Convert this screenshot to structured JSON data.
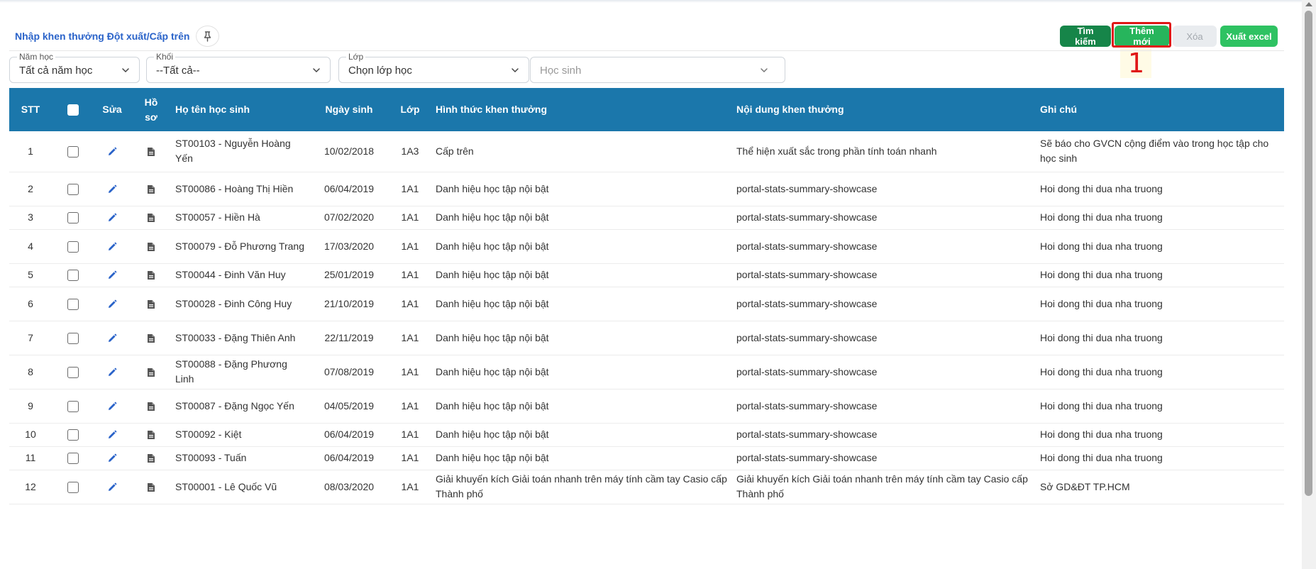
{
  "header": {
    "title": "Nhập khen thưởng Đột xuất/Cấp trên",
    "pin_icon": "pin-icon"
  },
  "toolbar": {
    "search_label": "Tìm kiếm",
    "add_label": "Thêm mới",
    "delete_label": "Xóa",
    "export_label": "Xuất excel"
  },
  "annotation": {
    "step": "1",
    "color": "#e01717"
  },
  "filters": {
    "school_year": {
      "label": "Năm học",
      "value": "Tất cả năm học"
    },
    "grade": {
      "label": "Khối",
      "value": "--Tất cả--"
    },
    "class": {
      "label": "Lớp",
      "value": "Chọn lớp học"
    },
    "student": {
      "placeholder": "Học sinh"
    }
  },
  "table": {
    "header_color": "#1b77ab",
    "columns": {
      "stt": "STT",
      "edit": "Sửa",
      "profile_1": "Hồ",
      "profile_2": "sơ",
      "name": "Họ tên học sinh",
      "dob": "Ngày sinh",
      "class": "Lớp",
      "award_type": "Hình thức khen thưởng",
      "award_content": "Nội dung khen thưởng",
      "note": "Ghi chú"
    },
    "rows": [
      {
        "stt": "1",
        "name": "ST00103 - Nguyễn Hoàng Yến",
        "dob": "10/02/2018",
        "class": "1A3",
        "award_type": "Cấp trên",
        "award_content": "Thể hiện xuất sắc trong phần tính toán nhanh",
        "note": "Sẽ báo cho GVCN cộng điểm vào trong học tập cho học sinh"
      },
      {
        "stt": "2",
        "name": "ST00086 - Hoàng Thị Hiền",
        "dob": "06/04/2019",
        "class": "1A1",
        "award_type": "Danh hiệu học tập nội bật",
        "award_content": "portal-stats-summary-showcase",
        "note": "Hoi dong thi dua nha truong"
      },
      {
        "stt": "3",
        "name": "ST00057 - Hiền Hà",
        "dob": "07/02/2020",
        "class": "1A1",
        "award_type": "Danh hiệu học tập nội bật",
        "award_content": "portal-stats-summary-showcase",
        "note": "Hoi dong thi dua nha truong"
      },
      {
        "stt": "4",
        "name": "ST00079 - Đỗ Phương Trang",
        "dob": "17/03/2020",
        "class": "1A1",
        "award_type": "Danh hiệu học tập nội bật",
        "award_content": "portal-stats-summary-showcase",
        "note": "Hoi dong thi dua nha truong"
      },
      {
        "stt": "5",
        "name": "ST00044 - Đinh Văn Huy",
        "dob": "25/01/2019",
        "class": "1A1",
        "award_type": "Danh hiệu học tập nội bật",
        "award_content": "portal-stats-summary-showcase",
        "note": "Hoi dong thi dua nha truong"
      },
      {
        "stt": "6",
        "name": "ST00028 - Đinh Công Huy",
        "dob": "21/10/2019",
        "class": "1A1",
        "award_type": "Danh hiệu học tập nội bật",
        "award_content": "portal-stats-summary-showcase",
        "note": "Hoi dong thi dua nha truong"
      },
      {
        "stt": "7",
        "name": "ST00033 - Đặng Thiên Anh",
        "dob": "22/11/2019",
        "class": "1A1",
        "award_type": "Danh hiệu học tập nội bật",
        "award_content": "portal-stats-summary-showcase",
        "note": "Hoi dong thi dua nha truong"
      },
      {
        "stt": "8",
        "name": "ST00088 - Đặng Phương Linh",
        "dob": "07/08/2019",
        "class": "1A1",
        "award_type": "Danh hiệu học tập nội bật",
        "award_content": "portal-stats-summary-showcase",
        "note": "Hoi dong thi dua nha truong"
      },
      {
        "stt": "9",
        "name": "ST00087 - Đặng Ngọc Yến",
        "dob": "04/05/2019",
        "class": "1A1",
        "award_type": "Danh hiệu học tập nội bật",
        "award_content": "portal-stats-summary-showcase",
        "note": "Hoi dong thi dua nha truong"
      },
      {
        "stt": "10",
        "name": "ST00092 - Kiệt",
        "dob": "06/04/2019",
        "class": "1A1",
        "award_type": "Danh hiệu học tập nội bật",
        "award_content": "portal-stats-summary-showcase",
        "note": "Hoi dong thi dua nha truong"
      },
      {
        "stt": "11",
        "name": "ST00093 - Tuấn",
        "dob": "06/04/2019",
        "class": "1A1",
        "award_type": "Danh hiệu học tập nội bật",
        "award_content": "portal-stats-summary-showcase",
        "note": "Hoi dong thi dua nha truong"
      },
      {
        "stt": "12",
        "name": "ST00001 - Lê Quốc Vũ",
        "dob": "08/03/2020",
        "class": "1A1",
        "award_type": "Giải khuyến kích Giải toán nhanh trên máy tính cầm tay Casio cấp Thành phố",
        "award_content": "Giải khuyến kích Giải toán nhanh trên máy tính cầm tay Casio cấp Thành phố",
        "note": "Sở GD&ĐT TP.HCM"
      }
    ],
    "row_icons": {
      "edit": "pencil-icon",
      "profile": "document-icon",
      "select": "checkbox"
    }
  }
}
